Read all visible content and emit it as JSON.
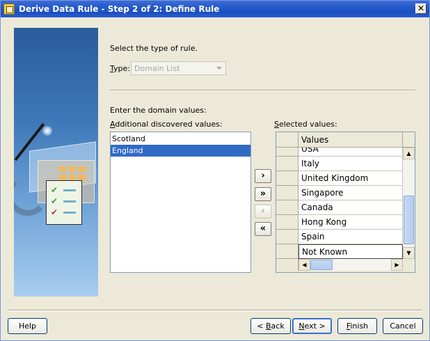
{
  "window": {
    "title": "Derive Data Rule - Step 2 of 2: Define Rule",
    "close_glyph": "✕"
  },
  "rule_type": {
    "prompt": "Select the type of rule.",
    "type_label_mnemonic": "T",
    "type_label_rest": "ype:",
    "type_value": "Domain List"
  },
  "domain": {
    "prompt": "Enter the domain values:",
    "additional_label_mnemonic": "A",
    "additional_label_rest": "dditional discovered values:",
    "additional_values": [
      "Scotland",
      "England"
    ],
    "selected_index": 1,
    "selected_label_mnemonic": "S",
    "selected_label_rest": "elected values:"
  },
  "move_buttons": {
    "move_one": "›",
    "move_all": "»",
    "remove_one": "‹",
    "remove_all": "«"
  },
  "selected_table": {
    "header": "Values",
    "rows": [
      "USA",
      "Italy",
      "United Kingdom",
      "Singapore",
      "Canada",
      "Hong Kong",
      "Spain",
      "Not Known"
    ]
  },
  "footer": {
    "help": "Help",
    "back_prefix": "< ",
    "back_mnemonic": "B",
    "back_rest": "ack",
    "next_mnemonic": "N",
    "next_rest": "ext >",
    "finish_mnemonic": "F",
    "finish_rest": "inish",
    "cancel": "Cancel"
  }
}
